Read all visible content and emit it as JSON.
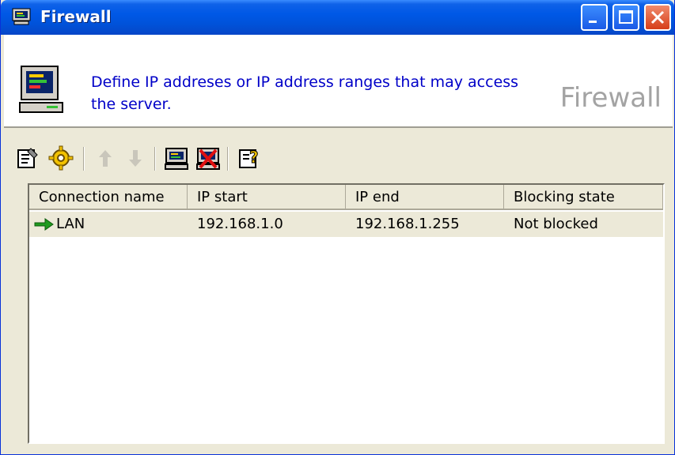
{
  "window": {
    "title": "Firewall",
    "buttons": [
      "minimize",
      "maximize",
      "close"
    ]
  },
  "header": {
    "description": "Define IP addreses or IP address ranges that may access the server.",
    "title": "Firewall",
    "icon": "computer-firewall-icon"
  },
  "toolbar": {
    "items": [
      {
        "icon": "properties-icon",
        "enabled": true
      },
      {
        "icon": "settings-gear-icon",
        "enabled": true
      },
      {
        "icon": "move-up-icon",
        "enabled": false
      },
      {
        "icon": "move-down-icon",
        "enabled": false
      },
      {
        "icon": "add-connection-icon",
        "enabled": true
      },
      {
        "icon": "delete-connection-icon",
        "enabled": true
      },
      {
        "icon": "help-icon",
        "enabled": true
      }
    ]
  },
  "list": {
    "columns": [
      "Connection name",
      "IP start",
      "IP end",
      "Blocking state"
    ],
    "rows": [
      {
        "name": "LAN",
        "ip_start": "192.168.1.0",
        "ip_end": "192.168.1.255",
        "state": "Not blocked",
        "icon": "green-arrow-icon"
      }
    ]
  },
  "colors": {
    "titlebar": "#0058e6",
    "header_desc": "#0000c8",
    "selection_row": "#ece9d8"
  }
}
